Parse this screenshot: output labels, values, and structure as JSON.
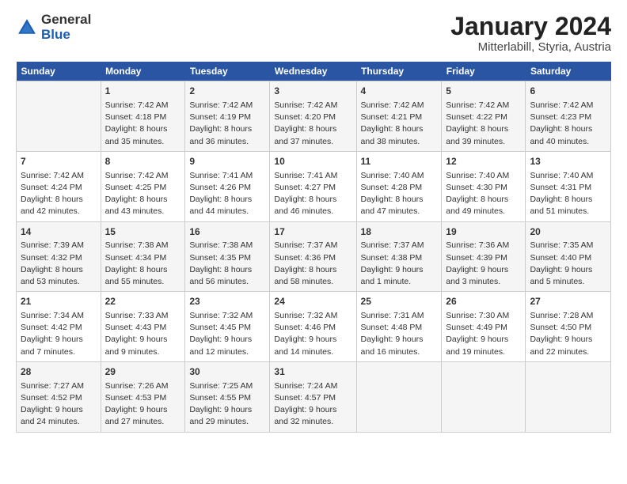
{
  "logo": {
    "general": "General",
    "blue": "Blue"
  },
  "title": "January 2024",
  "subtitle": "Mitterlabill, Styria, Austria",
  "days_of_week": [
    "Sunday",
    "Monday",
    "Tuesday",
    "Wednesday",
    "Thursday",
    "Friday",
    "Saturday"
  ],
  "weeks": [
    [
      {
        "day": "",
        "content": ""
      },
      {
        "day": "1",
        "content": "Sunrise: 7:42 AM\nSunset: 4:18 PM\nDaylight: 8 hours\nand 35 minutes."
      },
      {
        "day": "2",
        "content": "Sunrise: 7:42 AM\nSunset: 4:19 PM\nDaylight: 8 hours\nand 36 minutes."
      },
      {
        "day": "3",
        "content": "Sunrise: 7:42 AM\nSunset: 4:20 PM\nDaylight: 8 hours\nand 37 minutes."
      },
      {
        "day": "4",
        "content": "Sunrise: 7:42 AM\nSunset: 4:21 PM\nDaylight: 8 hours\nand 38 minutes."
      },
      {
        "day": "5",
        "content": "Sunrise: 7:42 AM\nSunset: 4:22 PM\nDaylight: 8 hours\nand 39 minutes."
      },
      {
        "day": "6",
        "content": "Sunrise: 7:42 AM\nSunset: 4:23 PM\nDaylight: 8 hours\nand 40 minutes."
      }
    ],
    [
      {
        "day": "7",
        "content": "Sunrise: 7:42 AM\nSunset: 4:24 PM\nDaylight: 8 hours\nand 42 minutes."
      },
      {
        "day": "8",
        "content": "Sunrise: 7:42 AM\nSunset: 4:25 PM\nDaylight: 8 hours\nand 43 minutes."
      },
      {
        "day": "9",
        "content": "Sunrise: 7:41 AM\nSunset: 4:26 PM\nDaylight: 8 hours\nand 44 minutes."
      },
      {
        "day": "10",
        "content": "Sunrise: 7:41 AM\nSunset: 4:27 PM\nDaylight: 8 hours\nand 46 minutes."
      },
      {
        "day": "11",
        "content": "Sunrise: 7:40 AM\nSunset: 4:28 PM\nDaylight: 8 hours\nand 47 minutes."
      },
      {
        "day": "12",
        "content": "Sunrise: 7:40 AM\nSunset: 4:30 PM\nDaylight: 8 hours\nand 49 minutes."
      },
      {
        "day": "13",
        "content": "Sunrise: 7:40 AM\nSunset: 4:31 PM\nDaylight: 8 hours\nand 51 minutes."
      }
    ],
    [
      {
        "day": "14",
        "content": "Sunrise: 7:39 AM\nSunset: 4:32 PM\nDaylight: 8 hours\nand 53 minutes."
      },
      {
        "day": "15",
        "content": "Sunrise: 7:38 AM\nSunset: 4:34 PM\nDaylight: 8 hours\nand 55 minutes."
      },
      {
        "day": "16",
        "content": "Sunrise: 7:38 AM\nSunset: 4:35 PM\nDaylight: 8 hours\nand 56 minutes."
      },
      {
        "day": "17",
        "content": "Sunrise: 7:37 AM\nSunset: 4:36 PM\nDaylight: 8 hours\nand 58 minutes."
      },
      {
        "day": "18",
        "content": "Sunrise: 7:37 AM\nSunset: 4:38 PM\nDaylight: 9 hours\nand 1 minute."
      },
      {
        "day": "19",
        "content": "Sunrise: 7:36 AM\nSunset: 4:39 PM\nDaylight: 9 hours\nand 3 minutes."
      },
      {
        "day": "20",
        "content": "Sunrise: 7:35 AM\nSunset: 4:40 PM\nDaylight: 9 hours\nand 5 minutes."
      }
    ],
    [
      {
        "day": "21",
        "content": "Sunrise: 7:34 AM\nSunset: 4:42 PM\nDaylight: 9 hours\nand 7 minutes."
      },
      {
        "day": "22",
        "content": "Sunrise: 7:33 AM\nSunset: 4:43 PM\nDaylight: 9 hours\nand 9 minutes."
      },
      {
        "day": "23",
        "content": "Sunrise: 7:32 AM\nSunset: 4:45 PM\nDaylight: 9 hours\nand 12 minutes."
      },
      {
        "day": "24",
        "content": "Sunrise: 7:32 AM\nSunset: 4:46 PM\nDaylight: 9 hours\nand 14 minutes."
      },
      {
        "day": "25",
        "content": "Sunrise: 7:31 AM\nSunset: 4:48 PM\nDaylight: 9 hours\nand 16 minutes."
      },
      {
        "day": "26",
        "content": "Sunrise: 7:30 AM\nSunset: 4:49 PM\nDaylight: 9 hours\nand 19 minutes."
      },
      {
        "day": "27",
        "content": "Sunrise: 7:28 AM\nSunset: 4:50 PM\nDaylight: 9 hours\nand 22 minutes."
      }
    ],
    [
      {
        "day": "28",
        "content": "Sunrise: 7:27 AM\nSunset: 4:52 PM\nDaylight: 9 hours\nand 24 minutes."
      },
      {
        "day": "29",
        "content": "Sunrise: 7:26 AM\nSunset: 4:53 PM\nDaylight: 9 hours\nand 27 minutes."
      },
      {
        "day": "30",
        "content": "Sunrise: 7:25 AM\nSunset: 4:55 PM\nDaylight: 9 hours\nand 29 minutes."
      },
      {
        "day": "31",
        "content": "Sunrise: 7:24 AM\nSunset: 4:57 PM\nDaylight: 9 hours\nand 32 minutes."
      },
      {
        "day": "",
        "content": ""
      },
      {
        "day": "",
        "content": ""
      },
      {
        "day": "",
        "content": ""
      }
    ]
  ]
}
